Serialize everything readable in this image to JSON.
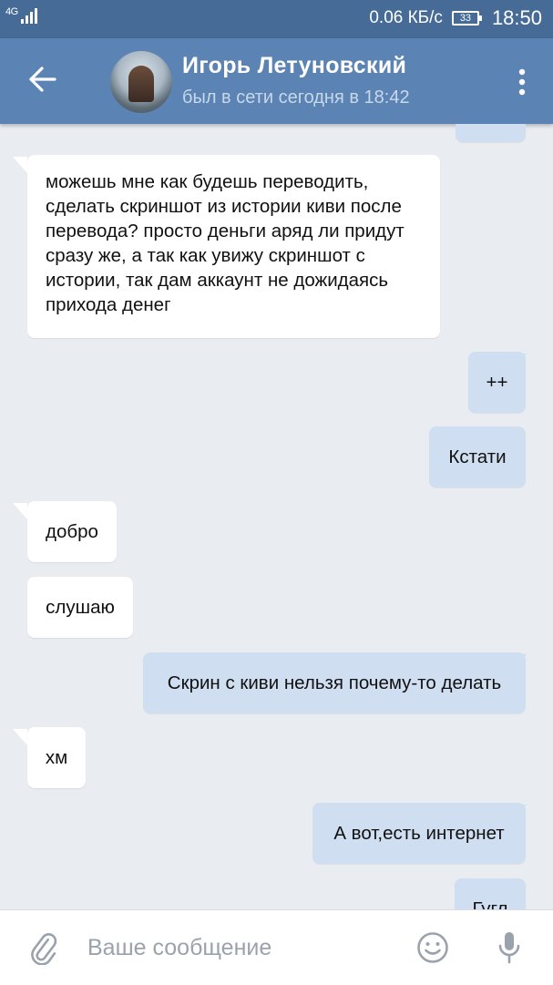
{
  "status_bar": {
    "network": "4G",
    "speed": "0.06 КБ/с",
    "battery": "33",
    "time": "18:50"
  },
  "header": {
    "contact_name": "Игорь Летуновский",
    "contact_status": "был в сети сегодня в 18:42",
    "icons": {
      "back": "arrow-left-icon",
      "menu": "more-vertical-icon"
    }
  },
  "messages": [
    {
      "direction": "in",
      "text": "можешь мне как будешь переводить, сделать скриншот из истории киви после перевода? просто деньги аряд ли придут сразу же, а так как увижу скриншот с истории, так дам аккаунт не дожидаясь прихода денег"
    },
    {
      "direction": "out",
      "text": "++"
    },
    {
      "direction": "out",
      "text": "Кстати"
    },
    {
      "direction": "in",
      "text": "добро"
    },
    {
      "direction": "in",
      "text": "слушаю"
    },
    {
      "direction": "out",
      "text": "Скрин с киви нельзя почему-то делать"
    },
    {
      "direction": "in",
      "text": "хм"
    },
    {
      "direction": "out",
      "text": "А вот,есть интернет"
    },
    {
      "direction": "out",
      "text": "Гугл"
    }
  ],
  "input_bar": {
    "placeholder": "Ваше сообщение",
    "icons": {
      "attach": "paperclip-icon",
      "emoji": "emoji-icon",
      "mic": "microphone-icon"
    }
  },
  "colors": {
    "status_bar": "#456b96",
    "header": "#5b83b3",
    "chat_bg": "#e9edf1",
    "bubble_in": "#ffffff",
    "bubble_out": "#cfdef0"
  }
}
